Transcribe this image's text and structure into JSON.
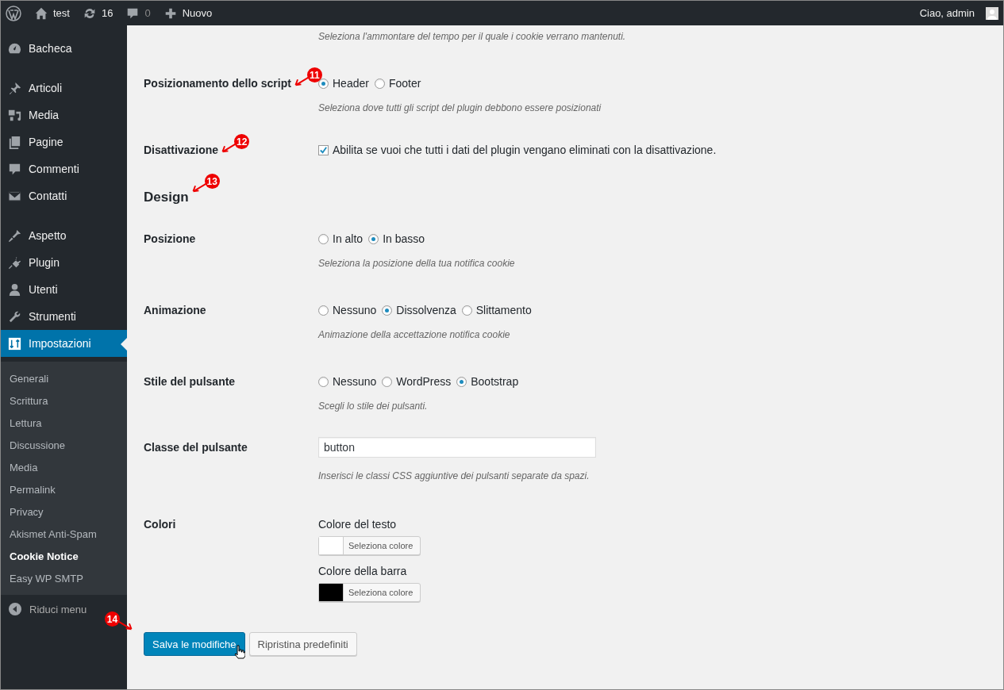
{
  "admin_bar": {
    "site": "test",
    "updates": "16",
    "comments": "0",
    "new": "Nuovo",
    "greeting": "Ciao, admin"
  },
  "menu": [
    {
      "items": [
        {
          "label": "Bacheca",
          "selected": false
        }
      ]
    },
    {
      "items": [
        {
          "label": "Articoli",
          "selected": false
        },
        {
          "label": "Media",
          "selected": false
        },
        {
          "label": "Pagine",
          "selected": false
        },
        {
          "label": "Commenti",
          "selected": false
        },
        {
          "label": "Contatti",
          "selected": false
        }
      ]
    },
    {
      "items": [
        {
          "label": "Aspetto",
          "selected": false
        },
        {
          "label": "Plugin",
          "selected": false
        },
        {
          "label": "Utenti",
          "selected": false
        },
        {
          "label": "Strumenti",
          "selected": false
        },
        {
          "label": "Impostazioni",
          "selected": true
        }
      ]
    }
  ],
  "submenu": [
    {
      "label": "Generali",
      "selected": false
    },
    {
      "label": "Scrittura",
      "selected": false
    },
    {
      "label": "Lettura",
      "selected": false
    },
    {
      "label": "Discussione",
      "selected": false
    },
    {
      "label": "Media",
      "selected": false
    },
    {
      "label": "Permalink",
      "selected": false
    },
    {
      "label": "Privacy",
      "selected": false
    },
    {
      "label": "Akismet Anti-Spam",
      "selected": false
    },
    {
      "label": "Cookie Notice",
      "selected": true
    },
    {
      "label": "Easy WP SMTP",
      "selected": false
    }
  ],
  "collapse": "Riduci menu",
  "top_hint": "Seleziona l'ammontare del tempo per il quale i cookie verrano mantenuti.",
  "settings": [
    {
      "kind": "radio",
      "label": "Posizionamento dello script",
      "annotation": "11",
      "options": [
        {
          "label": "Header",
          "selected": true
        },
        {
          "label": "Footer",
          "selected": false
        }
      ],
      "hint": "Seleziona dove tutti gli script del plugin debbono essere posizionati"
    },
    {
      "kind": "checkbox",
      "label": "Disattivazione",
      "annotation": "12",
      "checked": true,
      "text": "Abilita se vuoi che tutti i dati del plugin vengano eliminati con la disattivazione."
    },
    {
      "kind": "heading",
      "label": "Design",
      "annotation": "13"
    },
    {
      "kind": "radio",
      "label": "Posizione",
      "options": [
        {
          "label": "In alto",
          "selected": false
        },
        {
          "label": "In basso",
          "selected": true
        }
      ],
      "hint": "Seleziona la posizione della tua notifica cookie"
    },
    {
      "kind": "radio",
      "label": "Animazione",
      "options": [
        {
          "label": "Nessuno",
          "selected": false
        },
        {
          "label": "Dissolvenza",
          "selected": true
        },
        {
          "label": "Slittamento",
          "selected": false
        }
      ],
      "hint": "Animazione della accettazione notifica cookie"
    },
    {
      "kind": "radio",
      "label": "Stile del pulsante",
      "options": [
        {
          "label": "Nessuno",
          "selected": false
        },
        {
          "label": "WordPress",
          "selected": false
        },
        {
          "label": "Bootstrap",
          "selected": true
        }
      ],
      "hint": "Scegli lo stile dei pulsanti."
    },
    {
      "kind": "text",
      "label": "Classe del pulsante",
      "value": "button",
      "hint": "Inserisci le classi CSS aggiuntive dei pulsanti separate da spazi."
    },
    {
      "kind": "colors",
      "label": "Colori",
      "colors": [
        {
          "label": "Colore del testo",
          "color": "#ffffff",
          "button": "Seleziona colore"
        },
        {
          "label": "Colore della barra",
          "color": "#000000",
          "button": "Seleziona colore"
        }
      ]
    }
  ],
  "save": {
    "label": "Salva le modifiche",
    "annotation": "14"
  },
  "reset": "Ripristina predefiniti"
}
